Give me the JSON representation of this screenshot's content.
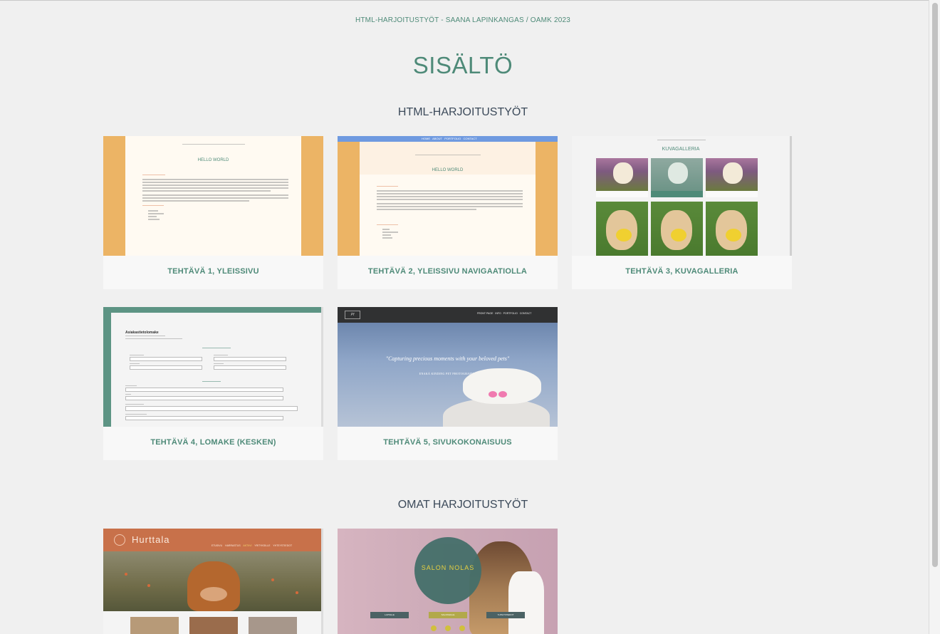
{
  "header": {
    "caption": "HTML-HARJOITUSTYÖT - SAANA LAPINKANGAS / OAMK 2023",
    "title": "SISÄLTÖ"
  },
  "sections": [
    {
      "title": "HTML-HARJOITUSTYÖT",
      "cards": [
        {
          "label": "TEHTÄVÄ 1, YLEISSIVU",
          "preview_heading": "HELLO WORLD"
        },
        {
          "label": "TEHTÄVÄ 2, YLEISSIVU NAVIGAATIOLLA",
          "preview_heading": "HELLO WORLD",
          "preview_nav": [
            "HOME",
            "ABOUT",
            "PORTFOLIO",
            "CONTACT"
          ]
        },
        {
          "label": "TEHTÄVÄ 3, KUVAGALLERIA",
          "preview_heading": "KUVAGALLERIA"
        },
        {
          "label": "TEHTÄVÄ 4, LOMAKE (KESKEN)",
          "preview_heading": "Asiakastietolomake"
        },
        {
          "label": "TEHTÄVÄ 5, SIVUKOKONAISUUS",
          "preview_quote": "\"Capturing precious moments with your beloved pets\"",
          "preview_sub": "ENAKÅ KINDING PET PHOTOGRAPHY",
          "preview_nav": [
            "FRONT PAGE",
            "INFO",
            "PORTFOLIO",
            "CONTACT"
          ]
        }
      ]
    },
    {
      "title": "OMAT HARJOITUSTYÖT",
      "cards": [
        {
          "preview_brand": "Hurttala",
          "preview_nav": [
            "ETUSIVU",
            "HARRASTUS",
            "AKTIIVI",
            "YRITYKSILLE",
            "YHTEYSTIEDOT"
          ]
        },
        {
          "preview_logo": "SALON NOLAS",
          "preview_buttons": [
            "LAPSILLE",
            "SALONGILLE",
            "YHTEYSTIEDOT"
          ]
        }
      ]
    }
  ],
  "colors": {
    "accent": "#4e8a78",
    "orange": "#ecb465",
    "section_title": "#3c4a5a",
    "card_bg": "#f8f8f8",
    "page_bg": "#f0f0f0"
  }
}
